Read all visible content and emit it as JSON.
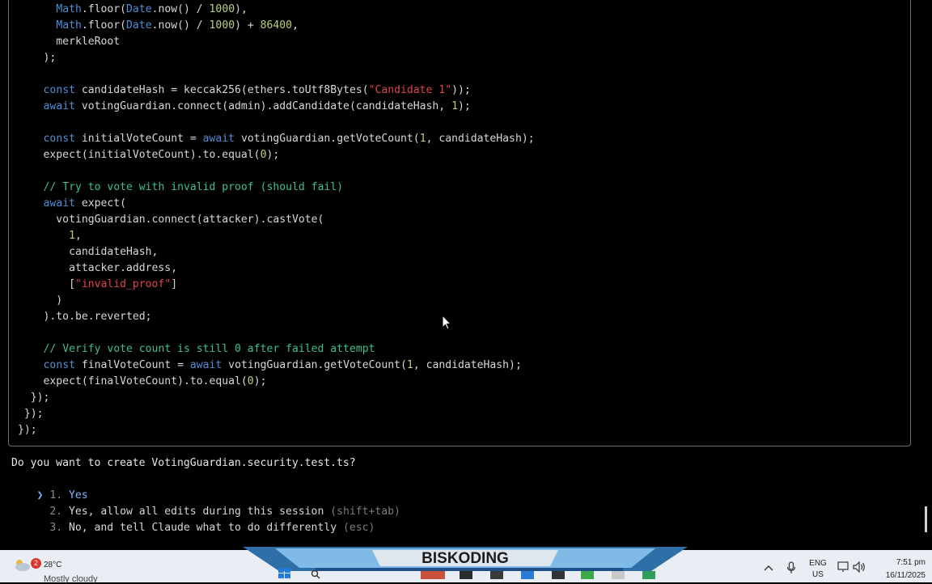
{
  "code_lines": [
    [
      {
        "t": "      "
      },
      {
        "t": "Math",
        "c": "obj"
      },
      {
        "t": ".floor("
      },
      {
        "t": "Date",
        "c": "obj"
      },
      {
        "t": ".now() / "
      },
      {
        "t": "1000",
        "c": "num"
      },
      {
        "t": "),"
      }
    ],
    [
      {
        "t": "      "
      },
      {
        "t": "Math",
        "c": "obj"
      },
      {
        "t": ".floor("
      },
      {
        "t": "Date",
        "c": "obj"
      },
      {
        "t": ".now() / "
      },
      {
        "t": "1000",
        "c": "num"
      },
      {
        "t": ") + "
      },
      {
        "t": "86400",
        "c": "num"
      },
      {
        "t": ","
      }
    ],
    [
      {
        "t": "      merkleRoot"
      }
    ],
    [
      {
        "t": "    );"
      }
    ],
    [
      {
        "t": ""
      }
    ],
    [
      {
        "t": "    "
      },
      {
        "t": "const",
        "c": "kw"
      },
      {
        "t": " candidateHash = keccak256(ethers.toUtf8Bytes("
      },
      {
        "t": "\"Candidate 1\"",
        "c": "str"
      },
      {
        "t": "));"
      }
    ],
    [
      {
        "t": "    "
      },
      {
        "t": "await",
        "c": "kw"
      },
      {
        "t": " votingGuardian.connect(admin).addCandidate(candidateHash, "
      },
      {
        "t": "1",
        "c": "num"
      },
      {
        "t": ");"
      }
    ],
    [
      {
        "t": ""
      }
    ],
    [
      {
        "t": "    "
      },
      {
        "t": "const",
        "c": "kw"
      },
      {
        "t": " initialVoteCount = "
      },
      {
        "t": "await",
        "c": "kw"
      },
      {
        "t": " votingGuardian.getVoteCount("
      },
      {
        "t": "1",
        "c": "num"
      },
      {
        "t": ", candidateHash);"
      }
    ],
    [
      {
        "t": "    expect(initialVoteCount).to.equal("
      },
      {
        "t": "0",
        "c": "num"
      },
      {
        "t": ");"
      }
    ],
    [
      {
        "t": ""
      }
    ],
    [
      {
        "t": "    "
      },
      {
        "t": "// Try to vote with invalid proof (should fail)",
        "c": "com"
      }
    ],
    [
      {
        "t": "    "
      },
      {
        "t": "await",
        "c": "kw"
      },
      {
        "t": " expect("
      }
    ],
    [
      {
        "t": "      votingGuardian.connect(attacker).castVote("
      }
    ],
    [
      {
        "t": "        "
      },
      {
        "t": "1",
        "c": "num"
      },
      {
        "t": ","
      }
    ],
    [
      {
        "t": "        candidateHash,"
      }
    ],
    [
      {
        "t": "        attacker.address,"
      }
    ],
    [
      {
        "t": "        ["
      },
      {
        "t": "\"invalid_proof\"",
        "c": "str"
      },
      {
        "t": "]"
      }
    ],
    [
      {
        "t": "      )"
      }
    ],
    [
      {
        "t": "    ).to.be.reverted;"
      }
    ],
    [
      {
        "t": ""
      }
    ],
    [
      {
        "t": "    "
      },
      {
        "t": "// Verify vote count is still 0 after failed attempt",
        "c": "com"
      }
    ],
    [
      {
        "t": "    "
      },
      {
        "t": "const",
        "c": "kw"
      },
      {
        "t": " finalVoteCount = "
      },
      {
        "t": "await",
        "c": "kw"
      },
      {
        "t": " votingGuardian.getVoteCount("
      },
      {
        "t": "1",
        "c": "num"
      },
      {
        "t": ", candidateHash);"
      }
    ],
    [
      {
        "t": "    expect(finalVoteCount).to.equal("
      },
      {
        "t": "0",
        "c": "num"
      },
      {
        "t": ");"
      }
    ],
    [
      {
        "t": "  });"
      }
    ],
    [
      {
        "t": " });"
      }
    ],
    [
      {
        "t": "});"
      }
    ]
  ],
  "prompt": {
    "question": "Do you want to create VotingGuardian.security.test.ts?",
    "selector": "❯",
    "options": [
      {
        "num": "1.",
        "label": "Yes",
        "hint": ""
      },
      {
        "num": "2.",
        "label": "Yes, allow all edits during this session",
        "hint": "(shift+tab)"
      },
      {
        "num": "3.",
        "label": "No, and tell Claude what to do differently",
        "hint": "(esc)"
      }
    ]
  },
  "taskbar": {
    "notification_count": "2",
    "temperature": "28°C",
    "condition": "Mostly cloudy",
    "banner": "BISKODING",
    "language": "ENG",
    "region": "US",
    "time": "7:51 pm",
    "date": "16/11/2025"
  },
  "colors": {
    "keyword": "#4f8fd6",
    "number": "#b8d37a",
    "string": "#e0414a",
    "comment": "#3fc08a",
    "selected_option": "#7db7ff"
  }
}
